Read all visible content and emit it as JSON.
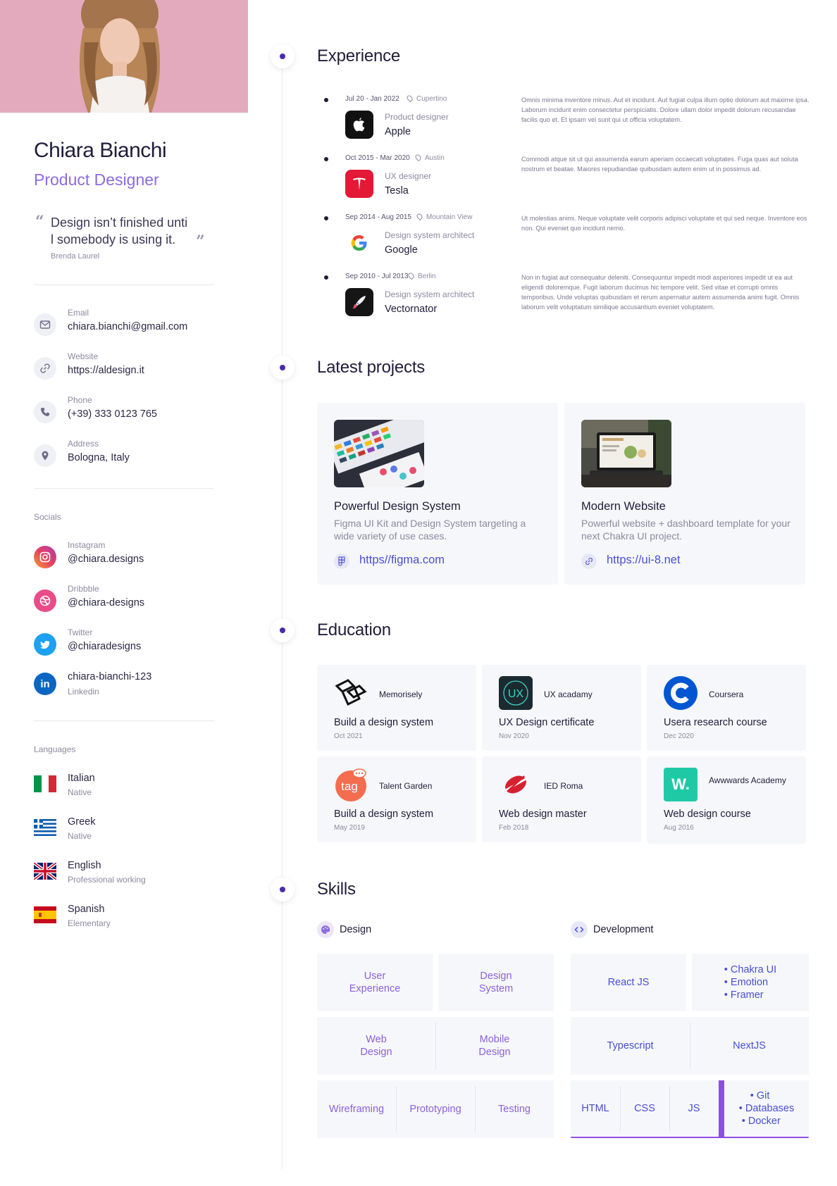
{
  "profile": {
    "name": "Chiara Bianchi",
    "role": "Product Designer",
    "quote": "Design isn’t finished until somebody is using it.",
    "quote_line1": "Design isn’t finished unti",
    "quote_line2": "l somebody is using it.",
    "quote_author": "Brenda Laurel"
  },
  "contacts": [
    {
      "label": "Email",
      "value": "chiara.bianchi@gmail.com",
      "icon": "mail-icon"
    },
    {
      "label": "Website",
      "value": "https://aldesign.it",
      "icon": "link-icon"
    },
    {
      "label": "Phone",
      "value": "(+39) 333 0123 765",
      "icon": "phone-icon"
    },
    {
      "label": "Address",
      "value": "Bologna, Italy",
      "icon": "location-pin-icon"
    }
  ],
  "socials": {
    "label": "Socials",
    "items": [
      {
        "network": "Instagram",
        "handle": "@chiara.designs",
        "icon": "instagram-icon"
      },
      {
        "network": "Dribbble",
        "handle": "@chiara-designs",
        "icon": "dribbble-icon"
      },
      {
        "network": "Twitter",
        "handle": "@chiaradesigns",
        "icon": "twitter-icon"
      },
      {
        "network": "Linkedin",
        "handle": "chiara-bianchi-123",
        "icon": "linkedin-icon"
      }
    ]
  },
  "languages": {
    "label": "Languages",
    "items": [
      {
        "name": "Italian",
        "level": "Native"
      },
      {
        "name": "Greek",
        "level": "Native"
      },
      {
        "name": "English",
        "level": "Professional working"
      },
      {
        "name": "Spanish",
        "level": "Elementary"
      }
    ]
  },
  "experience": {
    "title": "Experience",
    "items": [
      {
        "dates": "Jul 20 - Jan 2022",
        "location": "Cupertino",
        "position": "Product designer",
        "company": "Apple",
        "icon": "apple-logo-icon",
        "description": "Omnis minima inventore minus. Aut et incidunt. Aut fugiat culpa illum optio dolorum aut maxime ipsa. Laborum incidunt enim consectetur perspiciatis. Dolore ullam dolor impedit dolorum recusandae facilis quo et. Et ipsam vel sunt qui ut officia voluptatem."
      },
      {
        "dates": "Oct 2015 - Mar 2020",
        "location": "Austin",
        "position": "UX designer",
        "company": "Tesla",
        "icon": "tesla-logo-icon",
        "description": "Commodi atque sit ut qui assumenda earum aperiam occaecati voluptates. Fuga quas aut soluta nostrum et beatae. Maiores repudiandae quibusdam autem enim ut in possimus ad."
      },
      {
        "dates": "Sep 2014 - Aug 2015",
        "location": "Mountain View",
        "position": "Design system architect",
        "company": "Google",
        "icon": "google-logo-icon",
        "description": "Ut molestias animi. Neque voluptate velit corporis adipisci voluptate et qui sed neque. Inventore eos non. Qui eveniet quo incidunt nemo."
      },
      {
        "dates": "Sep 2010 - Jul 2013",
        "location": "Berlin",
        "position": "Design system architect",
        "company": "Vectornator",
        "icon": "vectornator-logo-icon",
        "description": "Non in fugiat aut consequatur deleniti. Consequuntur impedit modi asperiores impedit ut ea aut eligendi doloremque. Fugit laborum ducimus hic tempore velit. Sed vitae et corrupti omnis temporibus. Unde voluptas quibusdam et rerum aspernatur autem assumenda animi fugit. Omnis laborum velit voluptatum similique accusantium eveniet voluptatem."
      }
    ]
  },
  "projects": {
    "title": "Latest projects",
    "items": [
      {
        "title": "Powerful Design System",
        "description": "Figma UI Kit and Design System targeting a wide variety of use cases.",
        "link": "https//figma.com",
        "icon": "figma-icon"
      },
      {
        "title": "Modern Website",
        "description": "Powerful website + dashboard template for your next Chakra UI project.",
        "link": "https://ui-8.net",
        "icon": "link-icon"
      }
    ]
  },
  "education": {
    "title": "Education",
    "items": [
      {
        "institution": "Memorisely",
        "course": "Build a design system",
        "date": "Oct 2021",
        "icon": "memorisely-logo-icon"
      },
      {
        "institution": "UX acadamy",
        "course": "UX Design certificate",
        "date": "Nov 2020",
        "icon": "ux-academy-logo-icon"
      },
      {
        "institution": "Coursera",
        "course": "Usera research course",
        "date": "Dec 2020",
        "icon": "coursera-logo-icon"
      },
      {
        "institution": "Talent Garden",
        "course": "Build a design system",
        "date": "May 2019",
        "icon": "talent-garden-logo-icon"
      },
      {
        "institution": "IED Roma",
        "course": "Web design master",
        "date": "Feb 2018",
        "icon": "ied-logo-icon"
      },
      {
        "institution": "Awwwards Academy",
        "course": "Web design course",
        "date": "Aug 2016",
        "icon": "awwwards-logo-icon",
        "logo_text": "W."
      }
    ]
  },
  "skills": {
    "title": "Skills",
    "design": {
      "label": "Design",
      "rows": [
        [
          "User Experience",
          "Design System"
        ],
        [
          "Web Design",
          "Mobile Design"
        ],
        [
          "Wireframing",
          "Prototyping",
          "Testing"
        ]
      ]
    },
    "development": {
      "label": "Development",
      "rows": [
        [
          "React JS",
          [
            "Chakra UI",
            "Emotion",
            "Framer"
          ]
        ],
        [
          "Typescript",
          "NextJS"
        ],
        [
          "HTML",
          "CSS",
          "JS",
          [
            "Git",
            "Databases",
            "Docker"
          ]
        ]
      ]
    }
  },
  "colors": {
    "accent_purple": "#8d6ce0",
    "link_blue": "#4a4fd0",
    "timeline_dot": "#4b2aa8",
    "card_bg": "#f6f7fb"
  }
}
